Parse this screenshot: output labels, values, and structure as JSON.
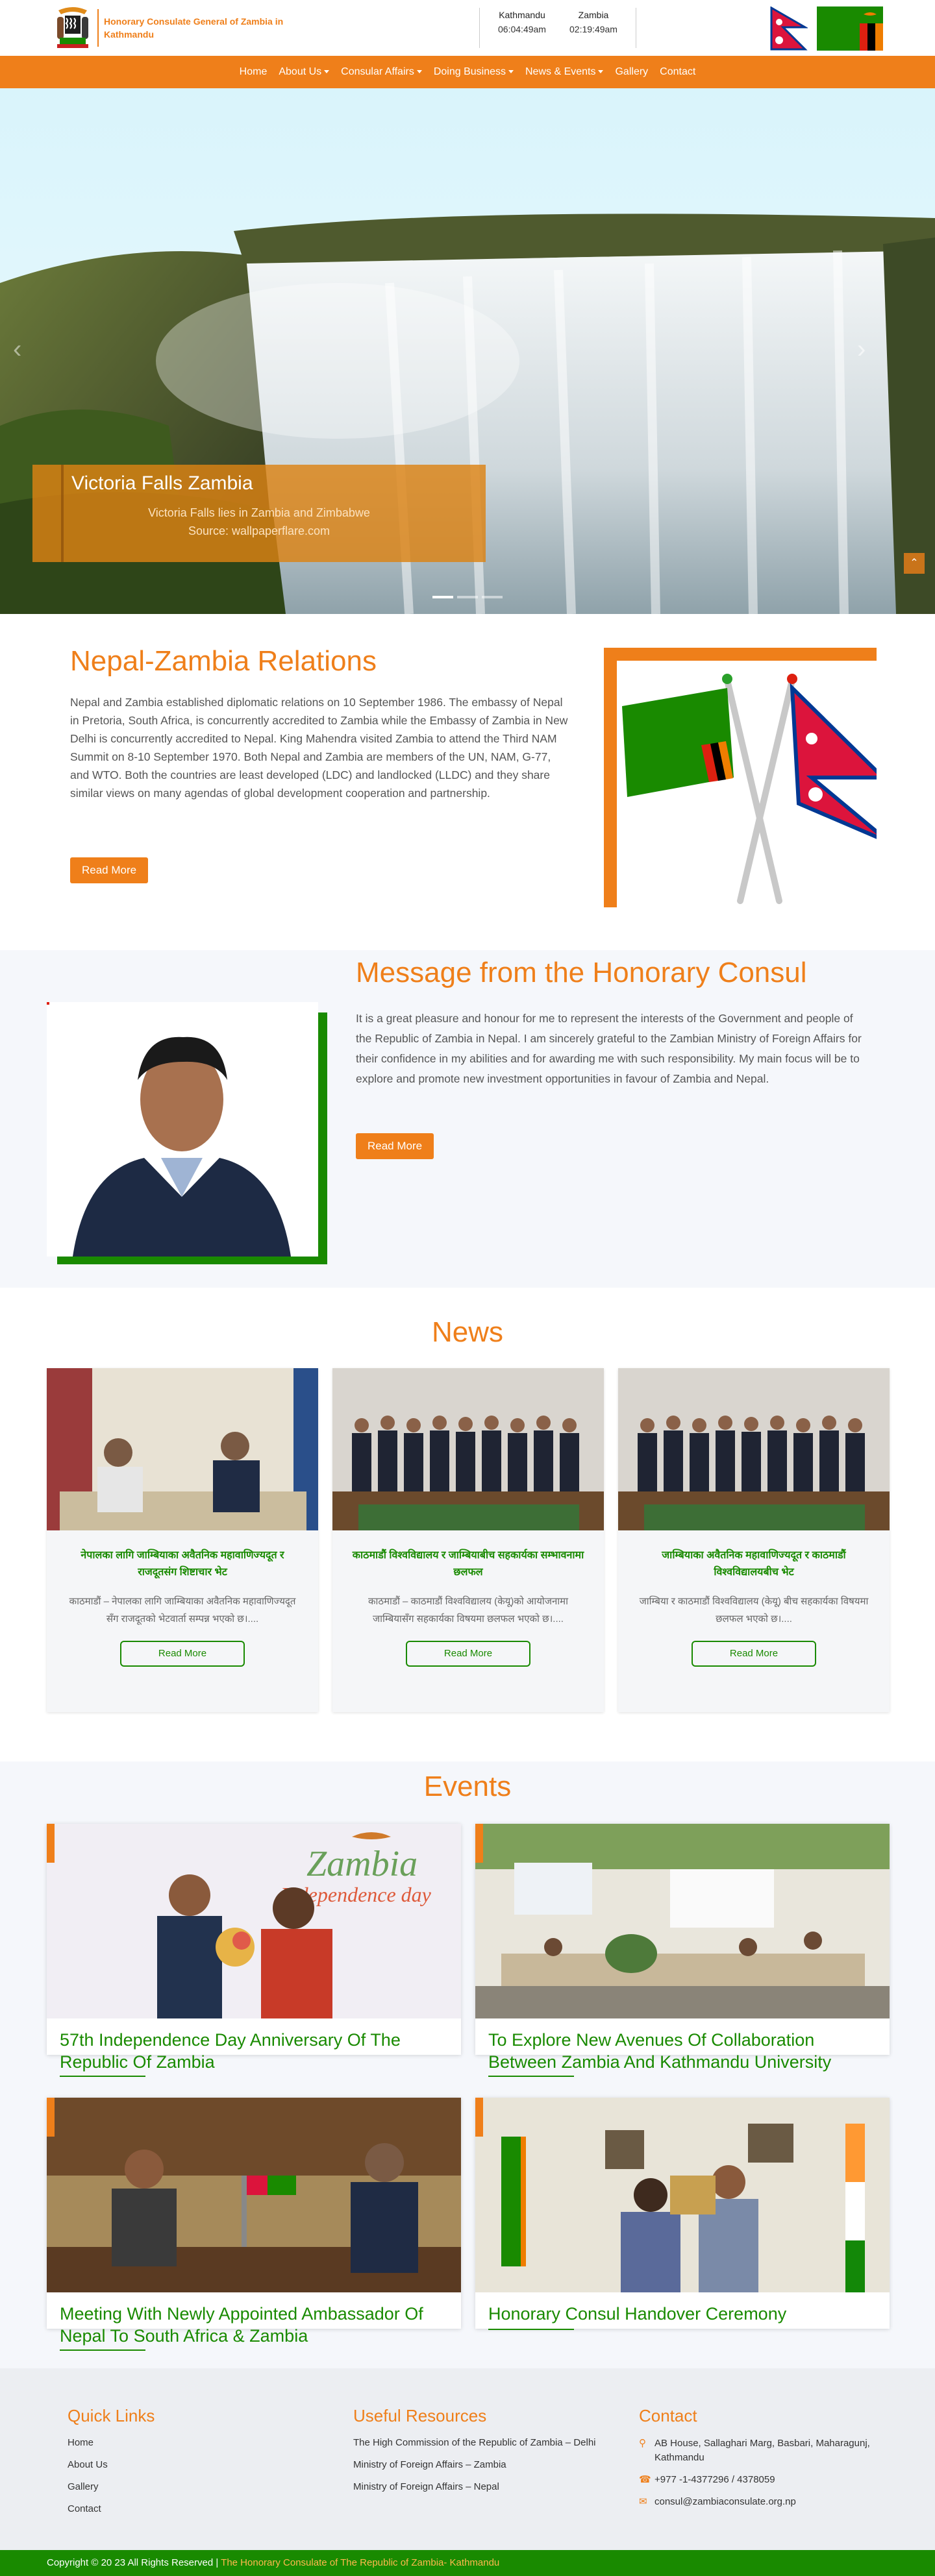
{
  "header": {
    "logo_text": "Honorary Consulate General of Zambia in Kathmandu",
    "clocks": [
      {
        "city": "Kathmandu",
        "time": "06:04:49am"
      },
      {
        "city": "Zambia",
        "time": "02:19:49am"
      }
    ]
  },
  "nav": {
    "items": [
      {
        "label": "Home",
        "dropdown": false
      },
      {
        "label": "About Us",
        "dropdown": true
      },
      {
        "label": "Consular Affairs",
        "dropdown": true
      },
      {
        "label": "Doing Business",
        "dropdown": true
      },
      {
        "label": "News & Events",
        "dropdown": true
      },
      {
        "label": "Gallery",
        "dropdown": false
      },
      {
        "label": "Contact",
        "dropdown": false
      }
    ]
  },
  "hero": {
    "title": "Victoria Falls Zambia",
    "subtitle": "Victoria Falls lies in Zambia and Zimbabwe",
    "source": "Source: wallpaperflare.com",
    "prev_icon": "chevron-left-icon",
    "next_icon": "chevron-right-icon",
    "slide_count": 3,
    "active_slide": 0
  },
  "relations": {
    "title": "Nepal-Zambia Relations",
    "text": "Nepal and Zambia established diplomatic relations on 10 September 1986. The embassy of Nepal in Pretoria, South Africa, is concurrently accredited to Zambia while the Embassy of Zambia in New Delhi is concurrently accredited to Nepal. King Mahendra visited Zambia to attend the Third NAM Summit on 8-10 September 1970. Both Nepal and Zambia are members of the UN, NAM, G-77, and WTO. Both the countries are least developed (LDC) and landlocked (LLDC) and they share similar views on many agendas of global development cooperation and partnership.",
    "button": "Read More"
  },
  "consul": {
    "title": "Message from the Honorary Consul",
    "text": "It is a great pleasure and honour for me to represent the interests of the Government and people of the Republic of Zambia in Nepal. I am sincerely grateful to the Zambian Ministry of Foreign Affairs for their confidence in my abilities and for awarding me with such responsibility. My main focus will be to explore and promote new investment opportunities in favour of Zambia and Nepal.",
    "button": "Read More"
  },
  "news": {
    "title": "News",
    "items": [
      {
        "headline": "नेपालका लागि जाम्बियाका अवैतनिक महावाणिज्यदूत र राजदूतसंग शिष्टाचार भेट",
        "excerpt": "काठमाडौं – नेपालका लागि जाम्बियाका अवैतनिक महावाणिज्यदूत सँग राजदूतको भेटवार्ता सम्पन्न भएको छ।....",
        "button": "Read More"
      },
      {
        "headline": "काठमाडौं विश्वविद्यालय र जाम्बियाबीच सहकार्यका सम्भावनामा छलफल",
        "excerpt": "काठमाडौं – काठमाडौं विश्वविद्यालय (केयू)को आयोजनामा जाम्बियासँग सहकार्यका विषयमा छलफल भएको छ।....",
        "button": "Read More"
      },
      {
        "headline": "जाम्बियाका अवैतनिक महावाणिज्यदूत र काठमाडौं विश्वविद्यालयबीच भेट",
        "excerpt": "जाम्बिया र काठमाडौं विश्वविद्यालय (केयू) बीच सहकार्यका विषयमा छलफल भएको छ।....",
        "button": "Read More"
      }
    ]
  },
  "events": {
    "title": "Events",
    "items": [
      {
        "title": "57th Independence Day Anniversary Of The Republic Of Zambia",
        "banner": "Zambia",
        "banner_sub": "Independence day"
      },
      {
        "title": "To Explore New Avenues Of Collaboration Between Zambia And Kathmandu University"
      },
      {
        "title": "Meeting With Newly Appointed Ambassador Of Nepal To South Africa & Zambia"
      },
      {
        "title": "Honorary Consul Handover Ceremony"
      }
    ]
  },
  "footer": {
    "quick_links": {
      "title": "Quick Links",
      "items": [
        "Home",
        "About Us",
        "Gallery",
        "Contact"
      ]
    },
    "resources": {
      "title": "Useful Resources",
      "items": [
        "The High Commission of the Republic of Zambia – Delhi",
        "Ministry of Foreign Affairs – Zambia",
        "Ministry of Foreign Affairs – Nepal"
      ]
    },
    "contact": {
      "title": "Contact",
      "address": "AB House, Sallaghari Marg, Basbari, Maharagunj, Kathmandu",
      "phone": "+977 -1-4377296 / 4378059",
      "email": "consul@zambiaconsulate.org.np",
      "icons": [
        "map-pin-icon",
        "phone-icon",
        "envelope-icon"
      ]
    },
    "copyright": "Copyright © 20 23 All Rights Reserved |",
    "copyright_org": "The Honorary Consulate of The Republic of Zambia- Kathmandu"
  },
  "colors": {
    "orange": "#ef7f1a",
    "green": "#198a00",
    "red": "#de2010",
    "black": "#000000"
  }
}
